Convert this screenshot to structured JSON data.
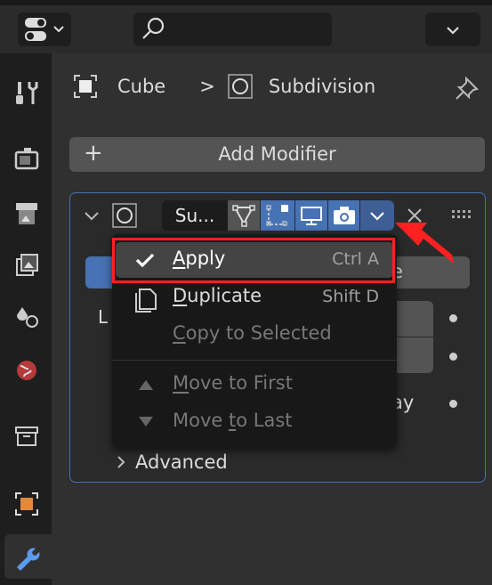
{
  "header": {
    "search_placeholder": "",
    "editor_icon": "properties-editor-icon"
  },
  "sidebar": {
    "items": [
      {
        "name": "tool",
        "icon": "tool-icon"
      },
      {
        "name": "render",
        "icon": "render-icon"
      },
      {
        "name": "output",
        "icon": "output-icon"
      },
      {
        "name": "view-layer",
        "icon": "view-layer-icon"
      },
      {
        "name": "scene",
        "icon": "scene-icon"
      },
      {
        "name": "world",
        "icon": "world-icon"
      },
      {
        "name": "collection",
        "icon": "collection-icon"
      },
      {
        "name": "object",
        "icon": "object-icon"
      },
      {
        "name": "modifiers",
        "icon": "wrench-icon",
        "active": true
      }
    ]
  },
  "breadcrumb": {
    "object": "Cube",
    "separator": ">",
    "modifier": "Subdivision"
  },
  "add_modifier": {
    "plus": "+",
    "label": "Add Modifier"
  },
  "modifier": {
    "name": "Su...",
    "bg_right_text": "e",
    "levels_label_partial": "L",
    "row_partial": "ay",
    "advanced": "Advanced"
  },
  "menu": {
    "items": [
      {
        "label": "Apply",
        "underline": "A",
        "rest": "pply",
        "shortcut": "Ctrl A",
        "enabled": true,
        "highlighted": true
      },
      {
        "label": "Duplicate",
        "underline": "D",
        "rest": "uplicate",
        "shortcut": "Shift D",
        "enabled": true
      },
      {
        "label": "Copy to Selected",
        "underline": "C",
        "rest": "opy to Selected",
        "shortcut": "",
        "enabled": false
      },
      {
        "label": "Move to First",
        "underline": "M",
        "rest": "ove to First",
        "shortcut": "",
        "enabled": false
      },
      {
        "label": "Move to Last",
        "pre": "Move ",
        "underline": "t",
        "rest": "o Last",
        "shortcut": "",
        "enabled": false
      }
    ]
  },
  "colors": {
    "accent": "#4772b3",
    "highlight_border": "#ff2020",
    "arrow": "#ff2020"
  }
}
